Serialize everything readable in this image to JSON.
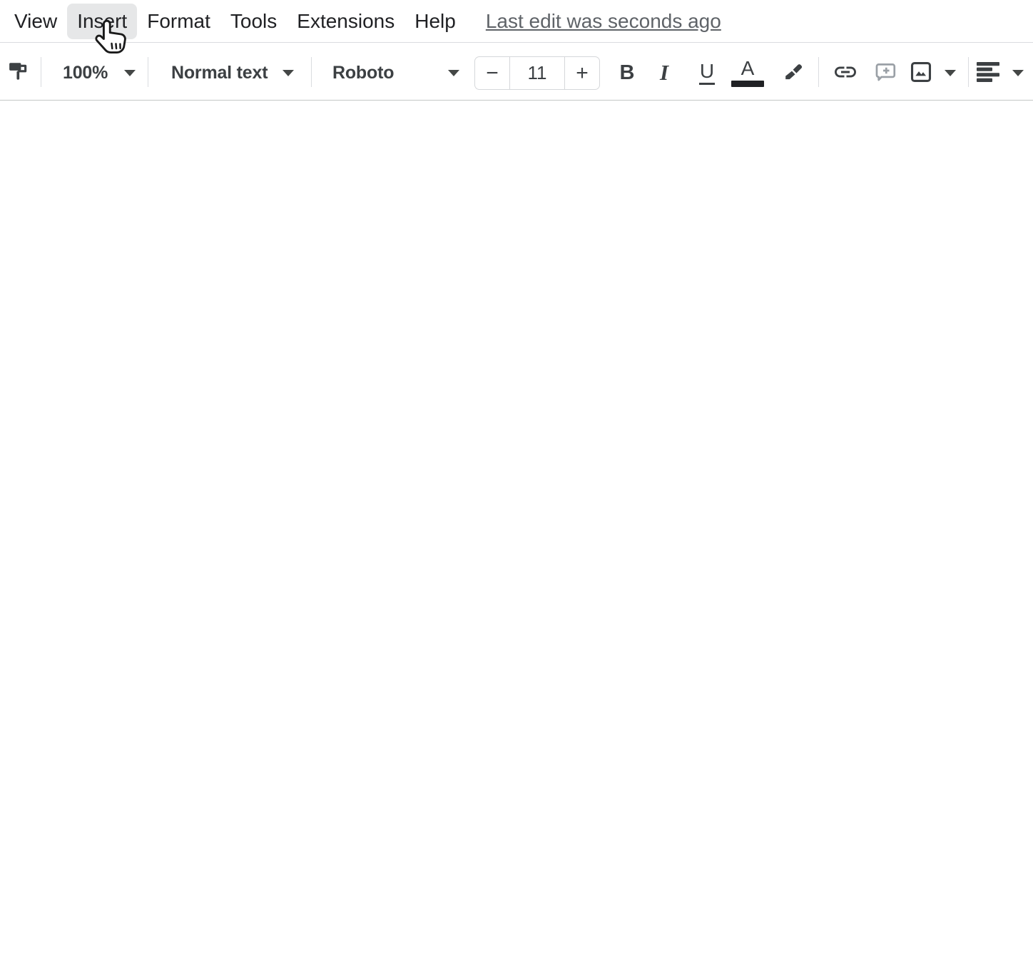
{
  "menu_bar": {
    "items": [
      {
        "label": "View",
        "state": "normal"
      },
      {
        "label": "Insert",
        "state": "hovered"
      },
      {
        "label": "Format",
        "state": "normal"
      },
      {
        "label": "Tools",
        "state": "normal"
      },
      {
        "label": "Extensions",
        "state": "normal"
      },
      {
        "label": "Help",
        "state": "normal"
      }
    ],
    "last_edit_status": "Last edit was seconds ago"
  },
  "toolbar": {
    "zoom": {
      "value": "100%"
    },
    "styles": {
      "value": "Normal text"
    },
    "font": {
      "value": "Roboto"
    },
    "font_size": {
      "value": "11",
      "decrease_label": "−",
      "increase_label": "+"
    },
    "bold_label": "B",
    "italic_label": "I",
    "underline_label": "U",
    "text_color_label": "A"
  },
  "icons": {
    "paint_format": "paint-roller",
    "dropdown": "caret-down-triangle",
    "highlight": "highlighter-marker",
    "link": "chain-link",
    "comment": "speech-bubble-plus",
    "image": "photo-mountains",
    "align": "align-left-lines",
    "cursor": "hand-pointer"
  },
  "colors": {
    "menu_text": "#202124",
    "status_text": "#5f6368",
    "toolbar_icon": "#3c4043",
    "muted_icon": "#9aa0a6",
    "hover_bg": "#e6e7e8",
    "divider": "#dadce0",
    "toolbar_border": "#c4c7c5",
    "text_color_swatch": "#202124",
    "background": "#ffffff"
  },
  "document": {
    "content": ""
  }
}
